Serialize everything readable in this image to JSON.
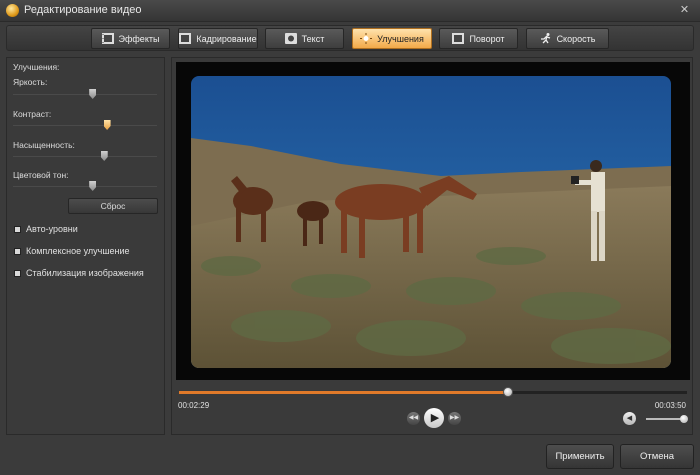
{
  "window": {
    "title": "Редактирование видео",
    "close_glyph": "✕"
  },
  "tabs": [
    {
      "label": "Эффекты",
      "icon": "film-effects-icon"
    },
    {
      "label": "Кадрирование",
      "icon": "crop-icon"
    },
    {
      "label": "Текст",
      "icon": "text-icon"
    },
    {
      "label": "Улучшения",
      "icon": "sun-icon",
      "active": true
    },
    {
      "label": "Поворот",
      "icon": "rotate-icon"
    },
    {
      "label": "Скорость",
      "icon": "running-man-icon"
    }
  ],
  "enhancements": {
    "heading": "Улучшения:",
    "sliders": [
      {
        "label": "Яркость:",
        "value_fraction": 0.55
      },
      {
        "label": "Контраст:",
        "value_fraction": 0.65
      },
      {
        "label": "Насыщенность:",
        "value_fraction": 0.63
      },
      {
        "label": "Цветовой тон:",
        "value_fraction": 0.55
      }
    ],
    "reset_label": "Сброс",
    "checkboxes": [
      {
        "label": "Авто-уровни",
        "checked": false
      },
      {
        "label": "Комплексное улучшение",
        "checked": false
      },
      {
        "label": "Стабилизация изображения",
        "checked": false
      }
    ]
  },
  "player": {
    "current_time": "00:02:29",
    "total_time": "00:03:50",
    "progress_fraction": 0.648,
    "volume_fraction": 1.0,
    "accent_color": "#e07a2a"
  },
  "footer": {
    "apply_label": "Применить",
    "cancel_label": "Отмена"
  }
}
